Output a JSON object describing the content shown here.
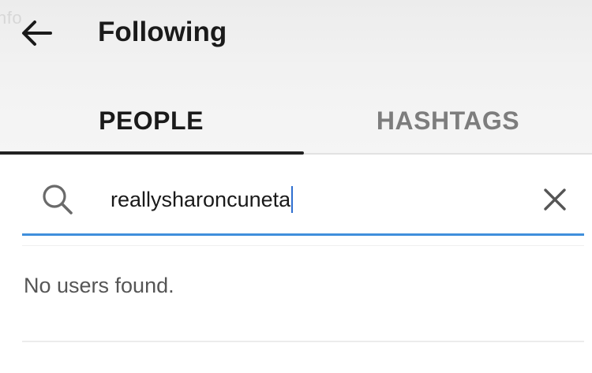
{
  "header": {
    "watermark": "nfo",
    "title": "Following",
    "back_icon": "arrow-left-icon"
  },
  "tabs": [
    {
      "label": "PEOPLE",
      "selected": true
    },
    {
      "label": "HASHTAGS",
      "selected": false
    }
  ],
  "search": {
    "value": "reallysharoncuneta",
    "search_icon": "search-icon",
    "clear_icon": "close-icon",
    "accent_color": "#3f8fdc"
  },
  "results": {
    "message": "No users found."
  }
}
